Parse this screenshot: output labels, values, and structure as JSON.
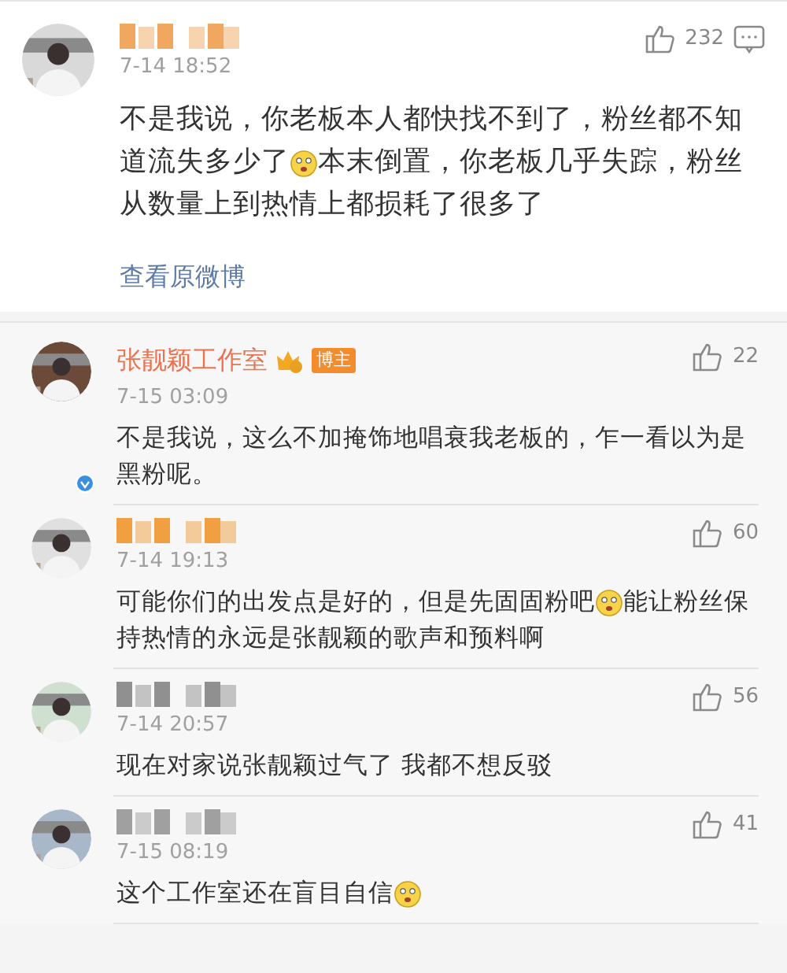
{
  "post": {
    "author": {
      "blurred": true,
      "color": "#f0a860"
    },
    "time": "7-14 18:52",
    "likes": "232",
    "lines": [
      [
        {
          "kind": "text",
          "text": "不是我说，你老板本人都快找不到了，粉丝都不知"
        }
      ],
      [
        {
          "kind": "text",
          "text": "道流失多少了"
        },
        {
          "kind": "emoji"
        },
        {
          "kind": "text",
          "text": "本末倒置，你老板几乎失踪，粉丝"
        }
      ],
      [
        {
          "kind": "text",
          "text": "从数量上到热情上都损耗了很多了"
        }
      ]
    ],
    "link": "查看原微博"
  },
  "replies": [
    {
      "author": {
        "blurred": false,
        "name": "张靓颖工作室",
        "badge": "博主",
        "verified": true
      },
      "time": "7-15 03:09",
      "likes": "22",
      "lines": [
        [
          {
            "kind": "text",
            "text": "不是我说，这么不加掩饰地唱衰我老板的，乍一看以为是"
          }
        ],
        [
          {
            "kind": "text",
            "text": "黑粉呢。"
          }
        ]
      ]
    },
    {
      "author": {
        "blurred": true,
        "color": "#f0a040"
      },
      "time": "7-14 19:13",
      "likes": "60",
      "lines": [
        [
          {
            "kind": "text",
            "text": "可能你们的出发点是好的，但是先固固粉吧"
          },
          {
            "kind": "emoji"
          },
          {
            "kind": "text",
            "text": "能让粉丝保"
          }
        ],
        [
          {
            "kind": "text",
            "text": "持热情的永远是张靓颖的歌声和预料啊"
          }
        ]
      ]
    },
    {
      "author": {
        "blurred": true,
        "color": "#909090"
      },
      "time": "7-14 20:57",
      "likes": "56",
      "lines": [
        [
          {
            "kind": "text",
            "text": "现在对家说张靓颖过气了  我都不想反驳"
          }
        ]
      ]
    },
    {
      "author": {
        "blurred": true,
        "color": "#a0a0a0"
      },
      "time": "7-15 08:19",
      "likes": "41",
      "lines": [
        [
          {
            "kind": "text",
            "text": "这个工作室还在盲目自信"
          },
          {
            "kind": "emoji"
          }
        ]
      ]
    }
  ]
}
